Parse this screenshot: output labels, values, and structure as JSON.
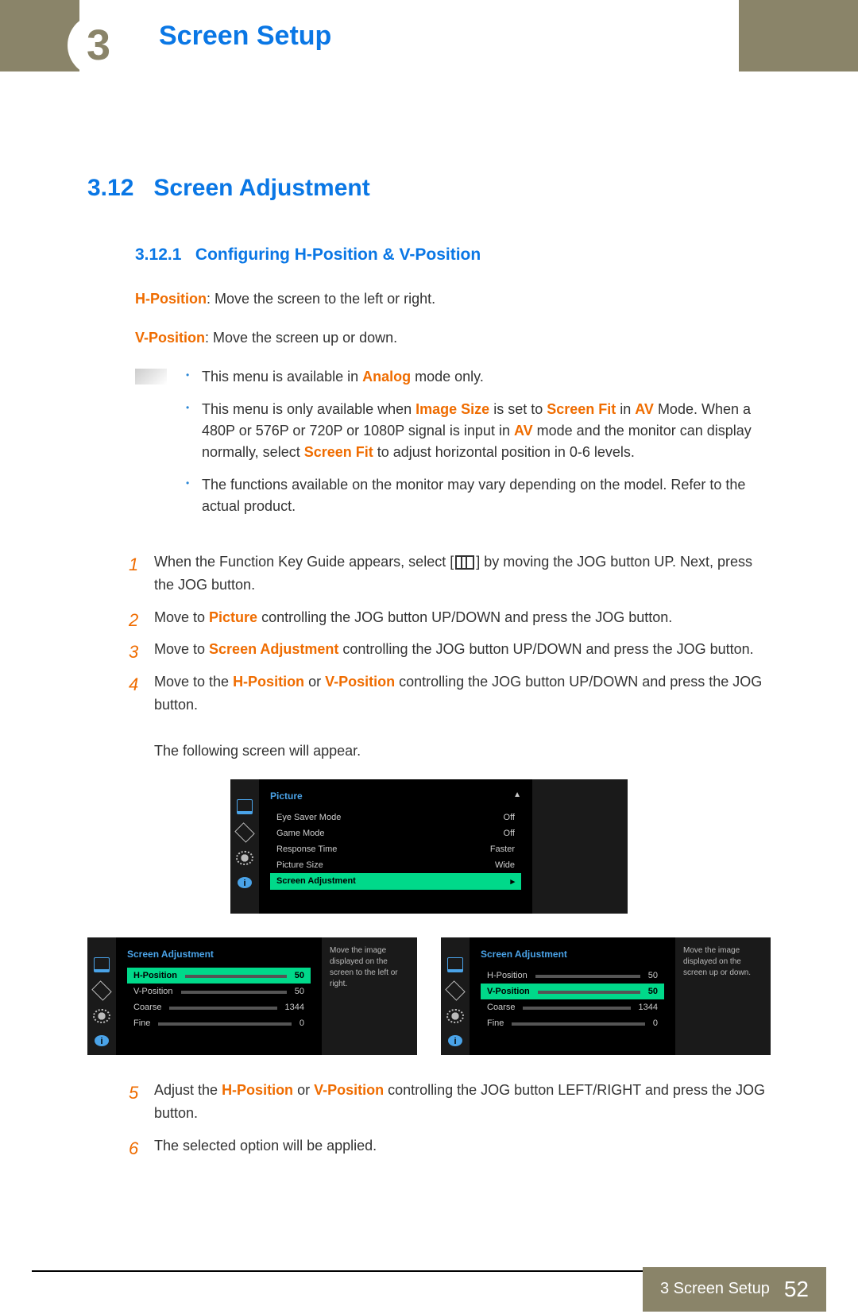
{
  "header": {
    "chapter_badge": "3",
    "title": "Screen Setup"
  },
  "section": {
    "number": "3.12",
    "title": "Screen Adjustment"
  },
  "subsection": {
    "number": "3.12.1",
    "title": "Configuring H-Position & V-Position"
  },
  "defs": {
    "h_label": "H-Position",
    "h_text": ": Move the screen to the left or right.",
    "v_label": "V-Position",
    "v_text": ": Move the screen up or down."
  },
  "notes": {
    "n1_a": "This menu is available in ",
    "n1_b": "Analog",
    "n1_c": " mode only.",
    "n2_a": "This menu is only available when ",
    "n2_b": "Image Size",
    "n2_c": " is set to ",
    "n2_d": "Screen Fit",
    "n2_e": " in ",
    "n2_f": "AV",
    "n2_g": " Mode. When a 480P or 576P or 720P or 1080P signal is input in ",
    "n2_h": "AV",
    "n2_i": " mode and the monitor can display normally, select ",
    "n2_j": "Screen Fit",
    "n2_k": " to adjust horizontal position in 0-6 levels.",
    "n3": "The functions available on the monitor may vary depending on the model. Refer to the actual product."
  },
  "steps": {
    "s1a": "When the Function Key Guide appears, select [",
    "s1b": "] by moving the JOG button UP. Next, press the JOG button.",
    "s2a": "Move to ",
    "s2b": "Picture",
    "s2c": " controlling the JOG button UP/DOWN and press the JOG button.",
    "s3a": "Move to ",
    "s3b": "Screen Adjustment",
    "s3c": " controlling the JOG button UP/DOWN and press the JOG button.",
    "s4a": "Move to the ",
    "s4b": "H-Position",
    "s4c": " or ",
    "s4d": "V-Position",
    "s4e": " controlling the JOG button UP/DOWN and press the JOG button.",
    "s4f": "The following screen will appear.",
    "s5a": "Adjust the ",
    "s5b": "H-Position",
    "s5c": " or ",
    "s5d": "V-Position",
    "s5e": " controlling the JOG button LEFT/RIGHT and press the JOG button.",
    "s6": "The selected option will be applied.",
    "n1": "1",
    "n2": "2",
    "n3": "3",
    "n4": "4",
    "n5": "5",
    "n6": "6"
  },
  "osd1": {
    "title": "Picture",
    "r1l": "Eye Saver Mode",
    "r1v": "Off",
    "r2l": "Game Mode",
    "r2v": "Off",
    "r3l": "Response Time",
    "r3v": "Faster",
    "r4l": "Picture Size",
    "r4v": "Wide",
    "r5l": "Screen Adjustment"
  },
  "osd2": {
    "title": "Screen Adjustment",
    "r1l": "H-Position",
    "r1v": "50",
    "r2l": "V-Position",
    "r2v": "50",
    "r3l": "Coarse",
    "r3v": "1344",
    "r4l": "Fine",
    "r4v": "0",
    "help": "Move the image displayed on the screen to the left or right."
  },
  "osd3": {
    "title": "Screen Adjustment",
    "r1l": "H-Position",
    "r1v": "50",
    "r2l": "V-Position",
    "r2v": "50",
    "r3l": "Coarse",
    "r3v": "1344",
    "r4l": "Fine",
    "r4v": "0",
    "help": "Move the image displayed on the screen up or down."
  },
  "footer": {
    "chapter": "3 Screen Setup",
    "page": "52"
  },
  "info_glyph": "i"
}
